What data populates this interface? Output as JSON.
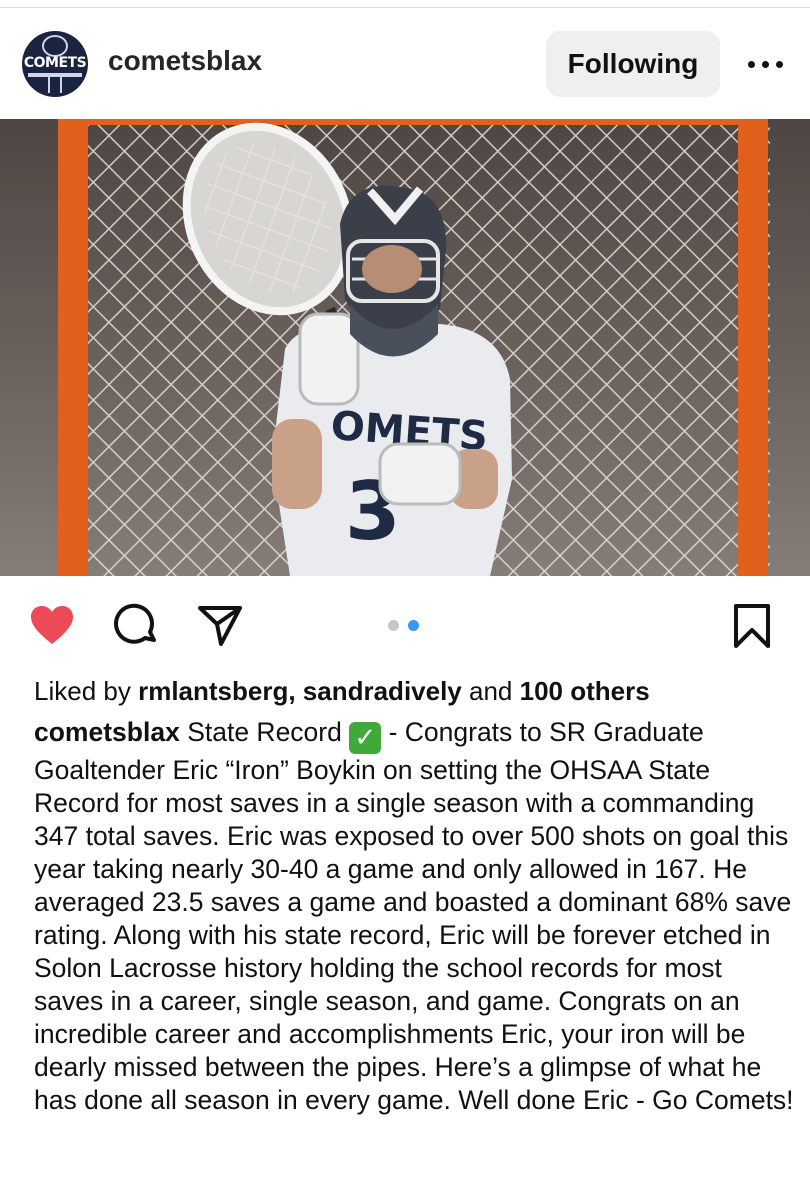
{
  "post": {
    "username": "cometsblax",
    "avatar_text": "COMETS",
    "follow_label": "Following",
    "more_icon": "more-horizontal-icon",
    "photo_alt_icon": "post-photo",
    "carousel": {
      "count": 2,
      "active_index": 1
    },
    "colors": {
      "like_red": "#ed4956",
      "dot_active": "#3897f0",
      "dot_inactive": "#c7c7c7"
    },
    "liked": true
  },
  "likes": {
    "prefix": "Liked by ",
    "user1": "rmlantsberg",
    "sep": ", ",
    "user2": "sandradively",
    "and": " and ",
    "others": "100 others"
  },
  "caption": {
    "username": "cometsblax",
    "line_start": " State Record ",
    "emoji": "✓",
    "text": " -  Congrats to SR Graduate Goaltender Eric “Iron” Boykin on setting the OHSAA State Record for most saves in a single season with a commanding 347 total saves. Eric was exposed to over 500 shots on goal this year taking nearly 30-40 a game and only allowed in 167. He averaged 23.5 saves a game and boasted a dominant 68% save rating. Along with his state record, Eric will be forever etched in Solon Lacrosse history holding the school records for most saves in a career, single season, and game. Congrats on an incredible career and accomplishments Eric, your iron will be dearly missed between the pipes. Here’s a glimpse of what he has done all season in every game. Well done Eric - Go Comets!"
  }
}
